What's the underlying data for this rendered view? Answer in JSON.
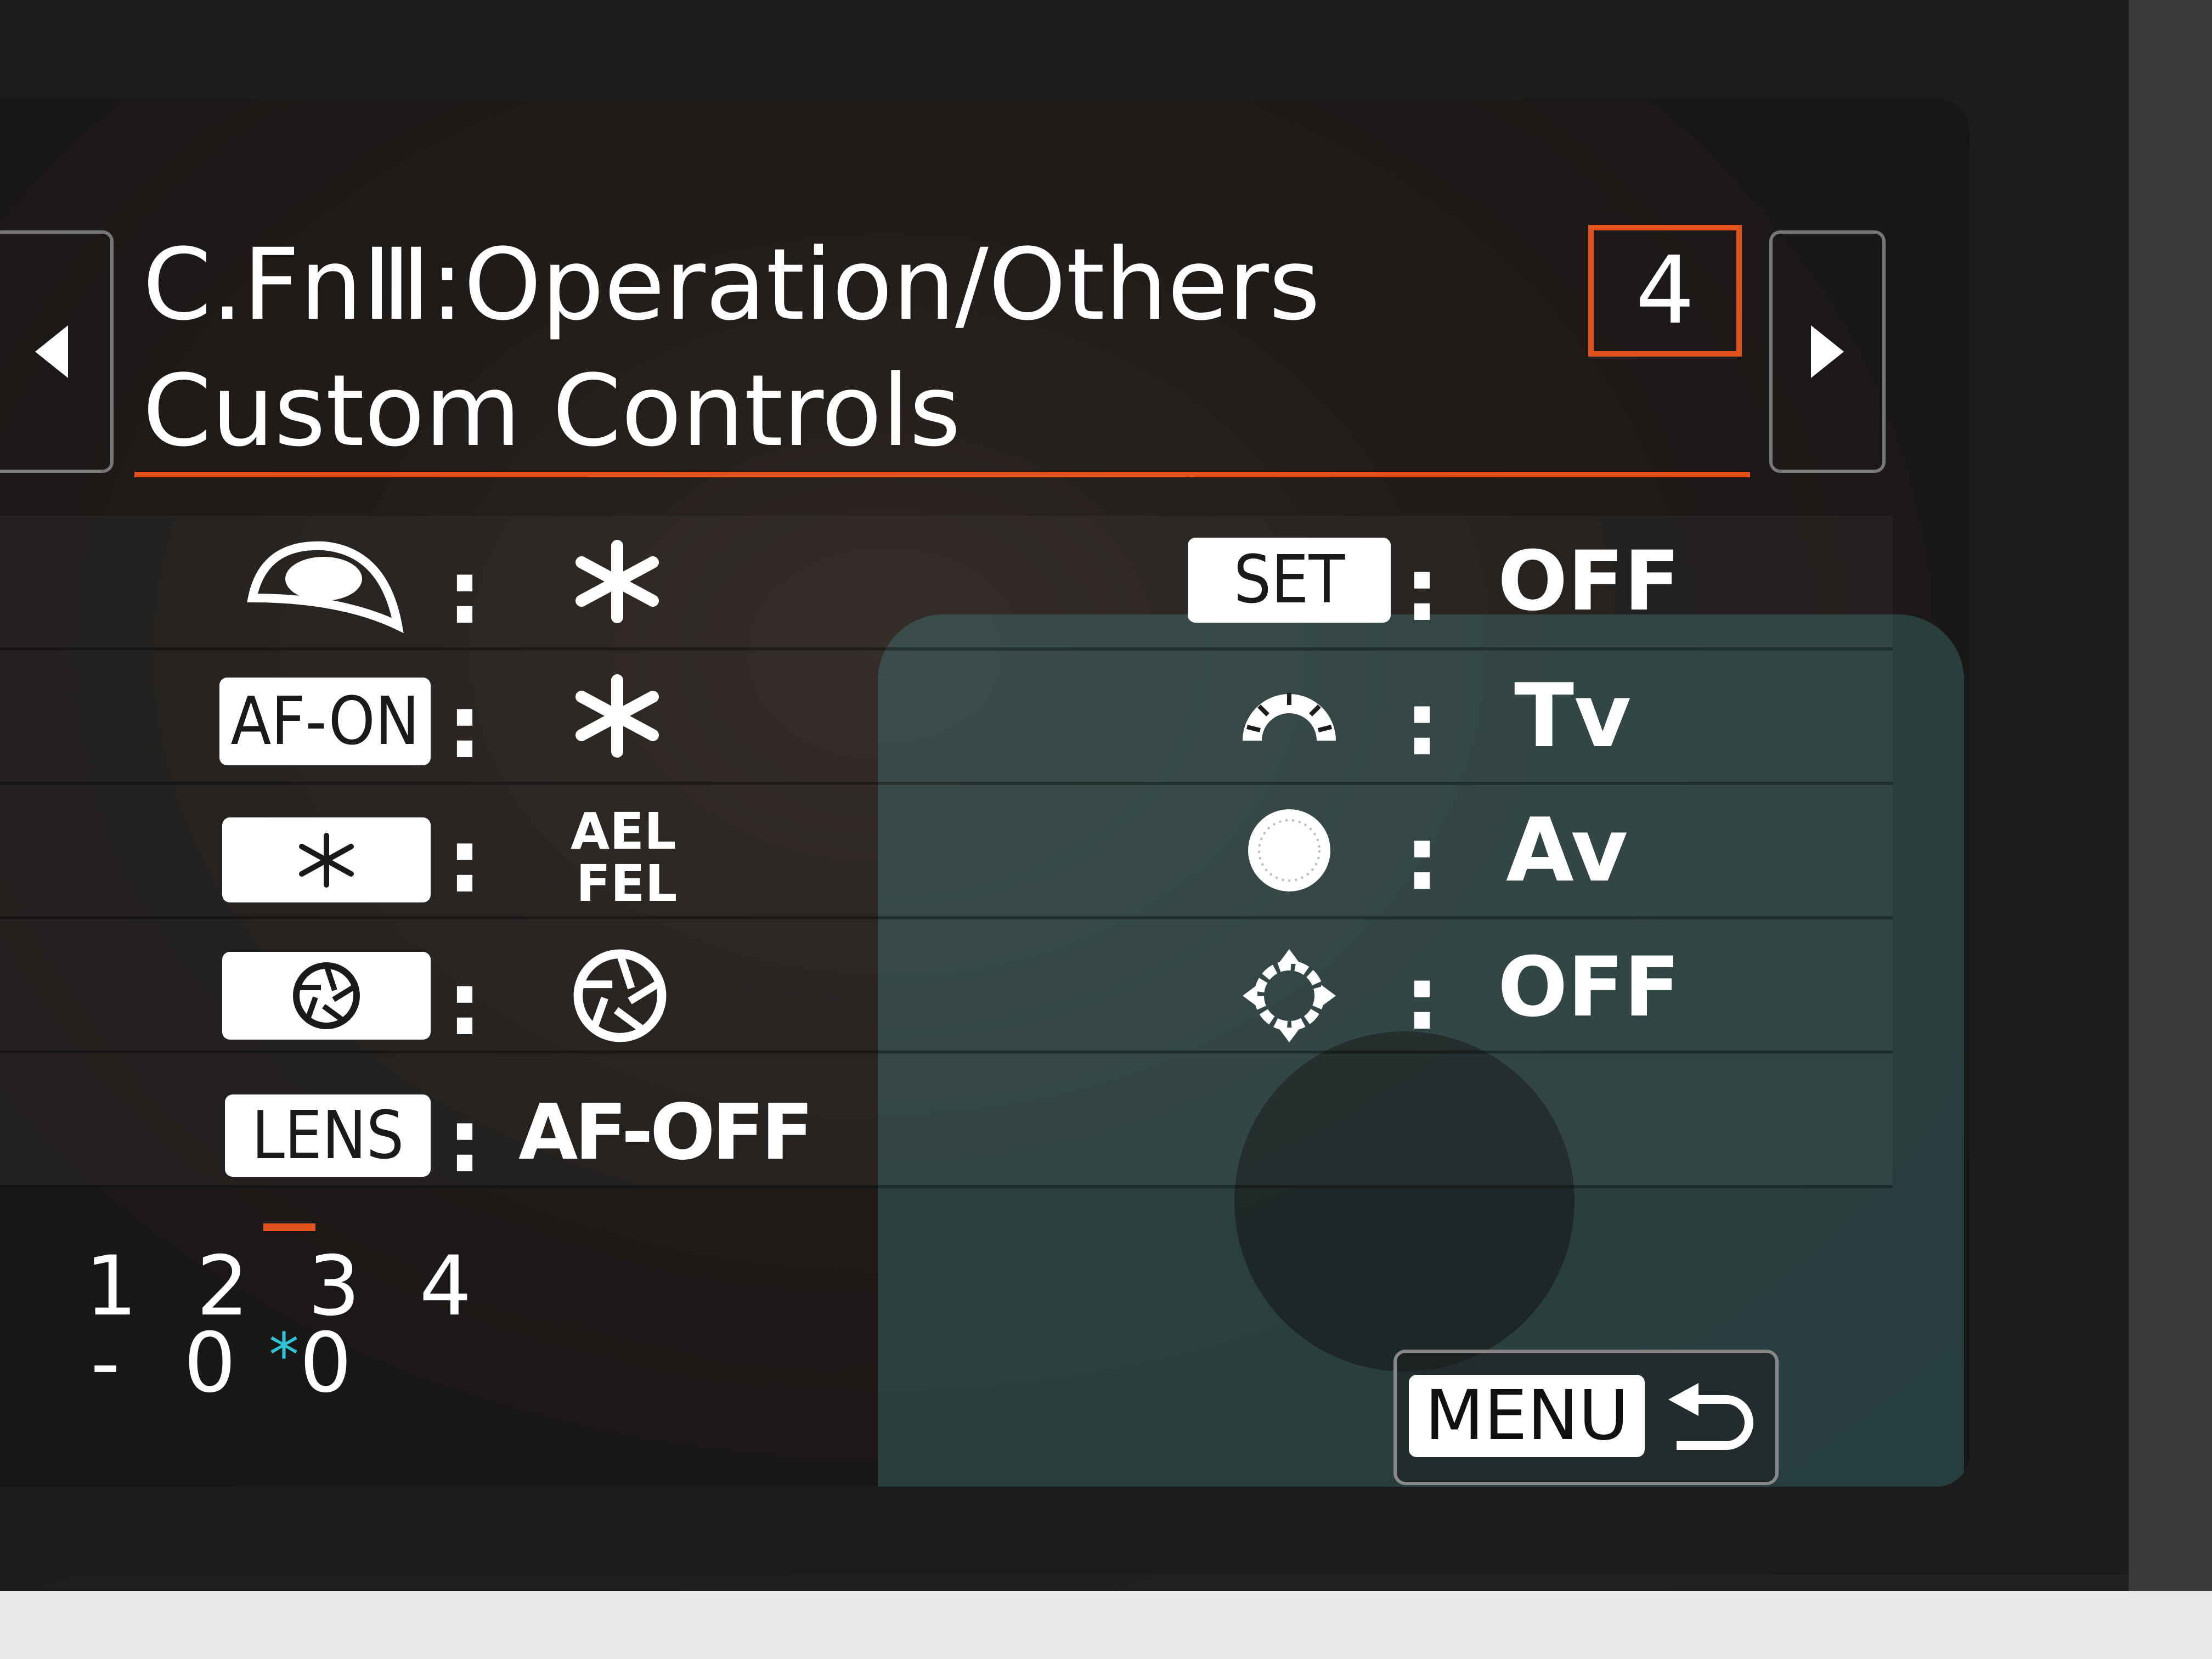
{
  "header": {
    "title_line1": "C.FnⅢ:Operation/Others",
    "title_line2": "Custom Controls",
    "page_number": "4"
  },
  "left_column": [
    {
      "icon": "shutter-half-press-icon",
      "label": "",
      "value_icon": "ae-lock-asterisk-icon",
      "value": ""
    },
    {
      "icon": "af-on-button",
      "label": "AF-ON",
      "value_icon": "ae-lock-asterisk-icon",
      "value": ""
    },
    {
      "icon": "ae-lock-button",
      "label": "∗",
      "value_line1": "AEL",
      "value_line2": "FEL"
    },
    {
      "icon": "dof-preview-button",
      "label": "",
      "value_icon": "aperture-icon",
      "value": ""
    },
    {
      "icon": "lens-button",
      "label": "LENS",
      "value": "AF-OFF"
    }
  ],
  "right_column": [
    {
      "icon": "set-button",
      "label": "SET",
      "value": "OFF"
    },
    {
      "icon": "main-dial-icon",
      "value": "Tv"
    },
    {
      "icon": "quick-control-dial-icon",
      "value": "Av"
    },
    {
      "icon": "multi-controller-icon",
      "value": "OFF"
    }
  ],
  "pages": {
    "numbers": "1 2 3 4",
    "status": "- 0 0",
    "status_asterisk": "*"
  },
  "menu_button": {
    "label": "MENU",
    "back_icon": "return-arrow-icon"
  },
  "colors": {
    "accent": "#e2521d",
    "asterisk": "#2ec4d6"
  }
}
